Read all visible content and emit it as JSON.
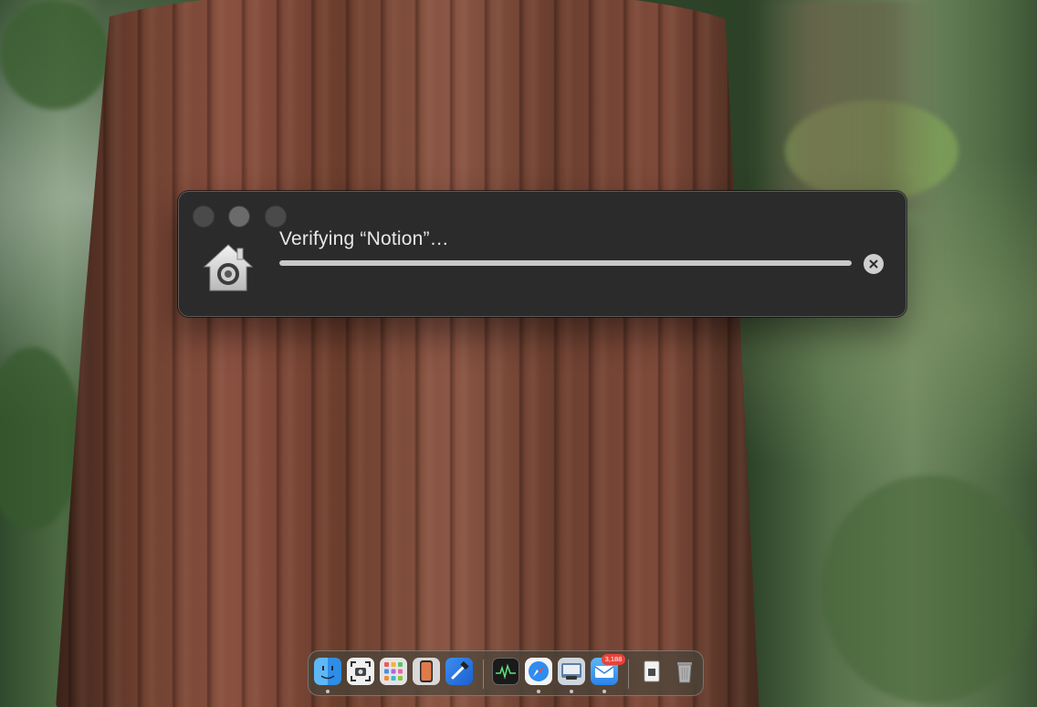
{
  "dialog": {
    "title": "Verifying “Notion”…",
    "progress": 1.0,
    "app_icon": "gatekeeper-house-lock-icon",
    "stop_icon": "stop-x-icon"
  },
  "dock": {
    "mail_badge": "3,188",
    "items": [
      {
        "name": "finder-icon",
        "running": true
      },
      {
        "name": "screenshot-icon",
        "running": false
      },
      {
        "name": "launchpad-icon",
        "running": false
      },
      {
        "name": "ios-simulator-icon",
        "running": false
      },
      {
        "name": "xcode-instruments-icon",
        "running": false
      },
      {
        "name": "activity-monitor-icon",
        "running": false
      },
      {
        "name": "safari-icon",
        "running": true
      },
      {
        "name": "preview-icon",
        "running": true
      },
      {
        "name": "mail-icon",
        "running": true
      },
      {
        "name": "downloads-stack-icon",
        "running": false
      },
      {
        "name": "trash-icon",
        "running": false
      }
    ]
  },
  "colors": {
    "dialog_bg": "#2b2b2b",
    "progress_fill": "#c9c9c9",
    "badge": "#e8423a"
  }
}
